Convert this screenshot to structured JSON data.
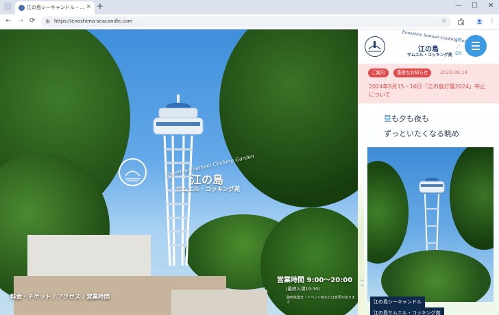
{
  "browser": {
    "tab_title": "江の島シーキャンドル・江の島サムエ...",
    "tab_close": "×",
    "new_tab": "+",
    "url": "https://enoshima-seacandle.com",
    "back": "←",
    "forward": "→",
    "reload": "⟳",
    "site_info": "⚙",
    "bookmark": "☆",
    "minimize": "—",
    "maximize": "☐",
    "close": "✕",
    "menu": "⋮"
  },
  "hero": {
    "brand_en": "Enoshima Samuel Cocking Garden",
    "brand_jp_main": "江の島",
    "brand_jp_sub": "サムエル・コッキング苑",
    "hours": "営業時間 9:00〜20:00",
    "last_entry": "(最終入場19:30)",
    "hours_note": "臨時休業日・イベント時などは変更があります",
    "nav": "料金・チケット  /  アクセス  /  営業時間"
  },
  "side": {
    "logo_en": "Enoshima Samuel Cocking Garden",
    "logo_jp_main": "江の島",
    "logo_jp_sub": "サムエル・コッキング苑",
    "lang_jp": "JP",
    "lang_sep": "／",
    "lang_en": "EN",
    "notice": {
      "badge_category": "ご案内",
      "badge_important": "重要なお知らせ",
      "date": "2024.08.14",
      "text": "2024年8月15・16日「江の島灯籠2024」中止について"
    },
    "tagline_1_hl": "昼",
    "tagline_1_rest": "も夕も夜も",
    "tagline_2": "ずっといたくなる眺め",
    "caption_1": "江の島シーキャンドル",
    "caption_2": "江の島サムエル・コッキング苑",
    "vertical_number": "3 3"
  },
  "colors": {
    "accent_blue": "#3a9be3",
    "notice_red": "#e04b4b",
    "notice_bg": "#fbe3e3",
    "navy": "#1e3c6e"
  }
}
